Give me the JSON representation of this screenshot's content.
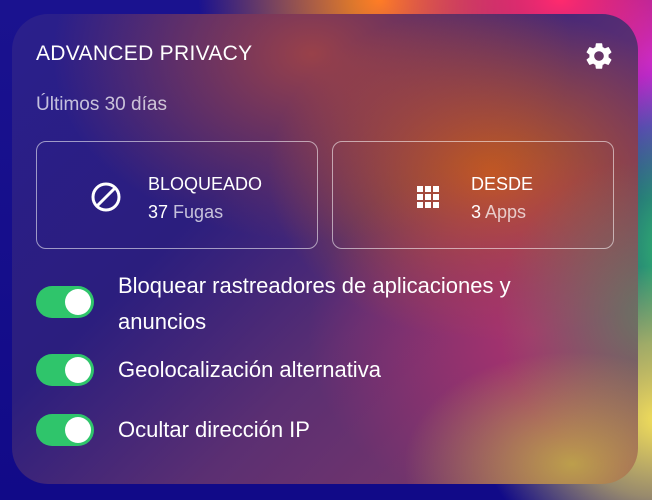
{
  "widget": {
    "title": "ADVANCED PRIVACY",
    "subtitle": "Últimos 30 días",
    "settings_icon": "gear-icon"
  },
  "stats": {
    "blocked": {
      "label": "BLOQUEADO",
      "count": "37",
      "unit": "Fugas",
      "icon": "block-icon"
    },
    "from": {
      "label": "DESDE",
      "count": "3",
      "unit": "Apps",
      "icon": "apps-grid-icon"
    }
  },
  "toggles": [
    {
      "label": "Bloquear rastreadores de aplicaciones y anuncios",
      "on": true
    },
    {
      "label": "Geolocalización alternativa",
      "on": true
    },
    {
      "label": "Ocultar dirección IP",
      "on": true
    }
  ],
  "colors": {
    "toggle_on": "#2fc56b",
    "text": "#ffffff"
  }
}
